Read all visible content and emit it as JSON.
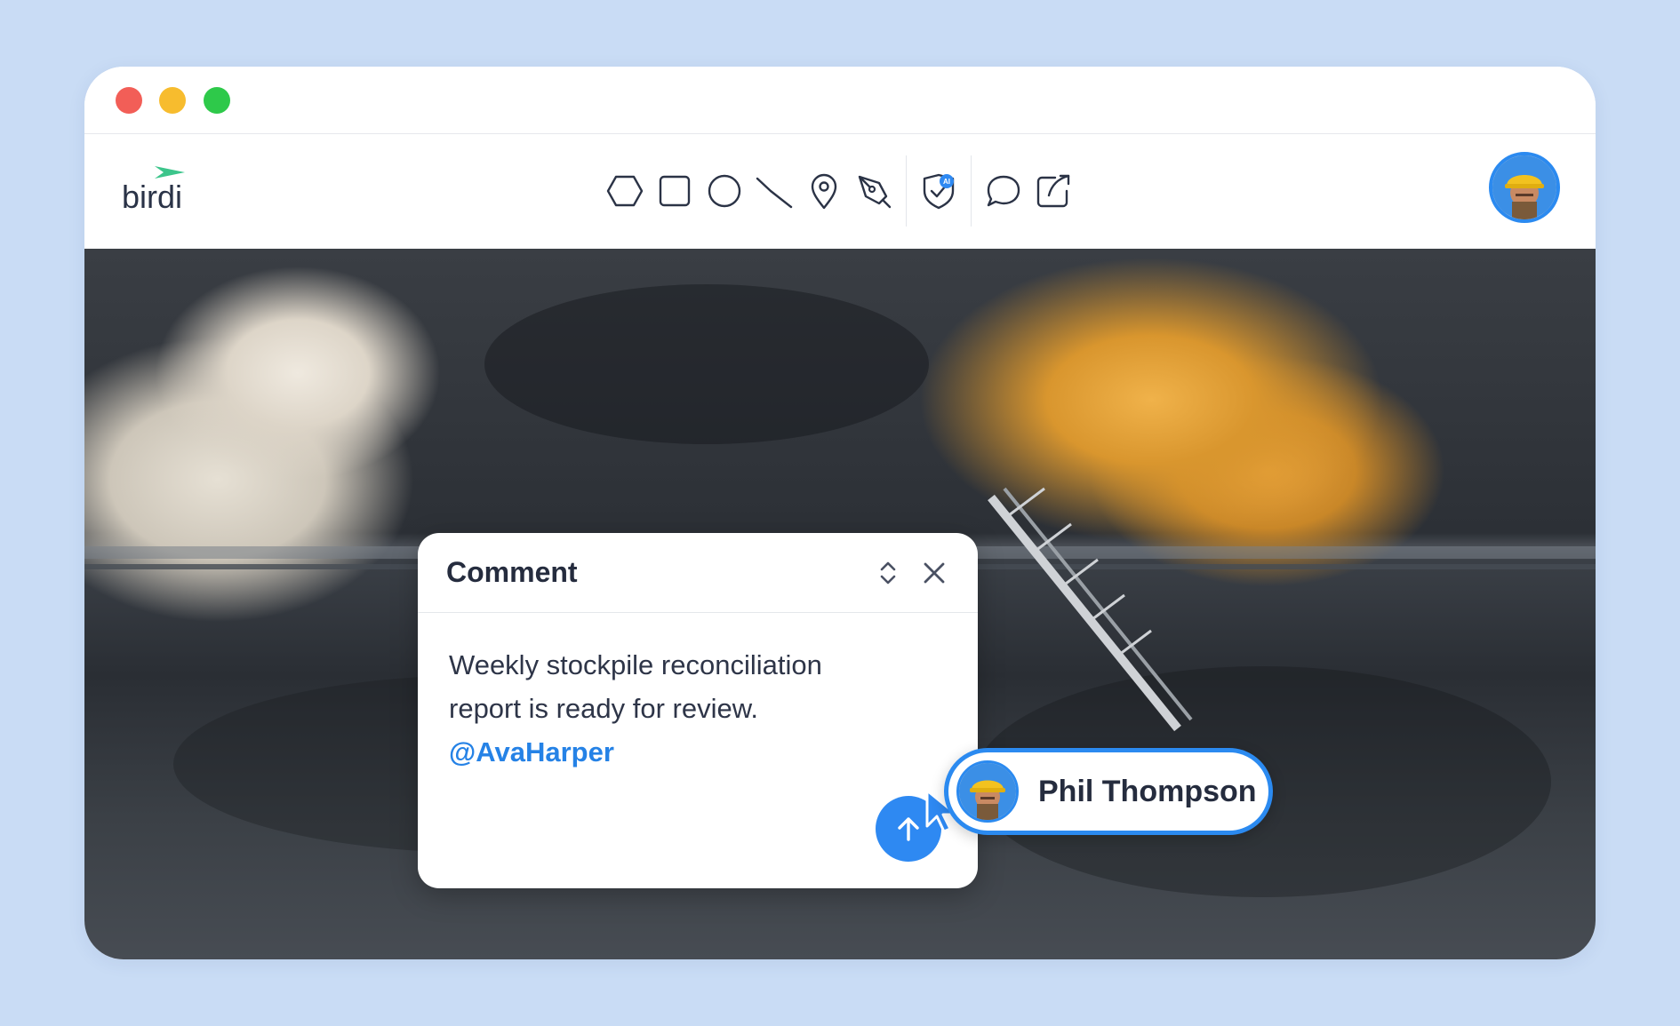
{
  "app": {
    "logo_text": "birdi"
  },
  "toolbar": {
    "tools": [
      {
        "name": "polygon-tool",
        "icon": "hexagon-icon"
      },
      {
        "name": "rectangle-tool",
        "icon": "square-icon"
      },
      {
        "name": "circle-tool",
        "icon": "circle-icon"
      },
      {
        "name": "line-tool",
        "icon": "line-icon"
      },
      {
        "name": "pin-tool",
        "icon": "map-pin-icon"
      },
      {
        "name": "pen-tool",
        "icon": "pen-icon"
      },
      {
        "name": "ai-detect-tool",
        "icon": "ai-shield-icon",
        "badge": "AI"
      },
      {
        "name": "comment-tool",
        "icon": "comment-icon"
      },
      {
        "name": "share-tool",
        "icon": "share-icon"
      }
    ]
  },
  "comment": {
    "title": "Comment",
    "body_line1": "Weekly stockpile reconciliation",
    "body_line2": "report is ready for review.",
    "mention": "@AvaHarper"
  },
  "user": {
    "name": "Phil Thompson"
  },
  "colors": {
    "accent": "#2e89f2",
    "text": "#252c3e",
    "background": "#c9dcf5"
  }
}
